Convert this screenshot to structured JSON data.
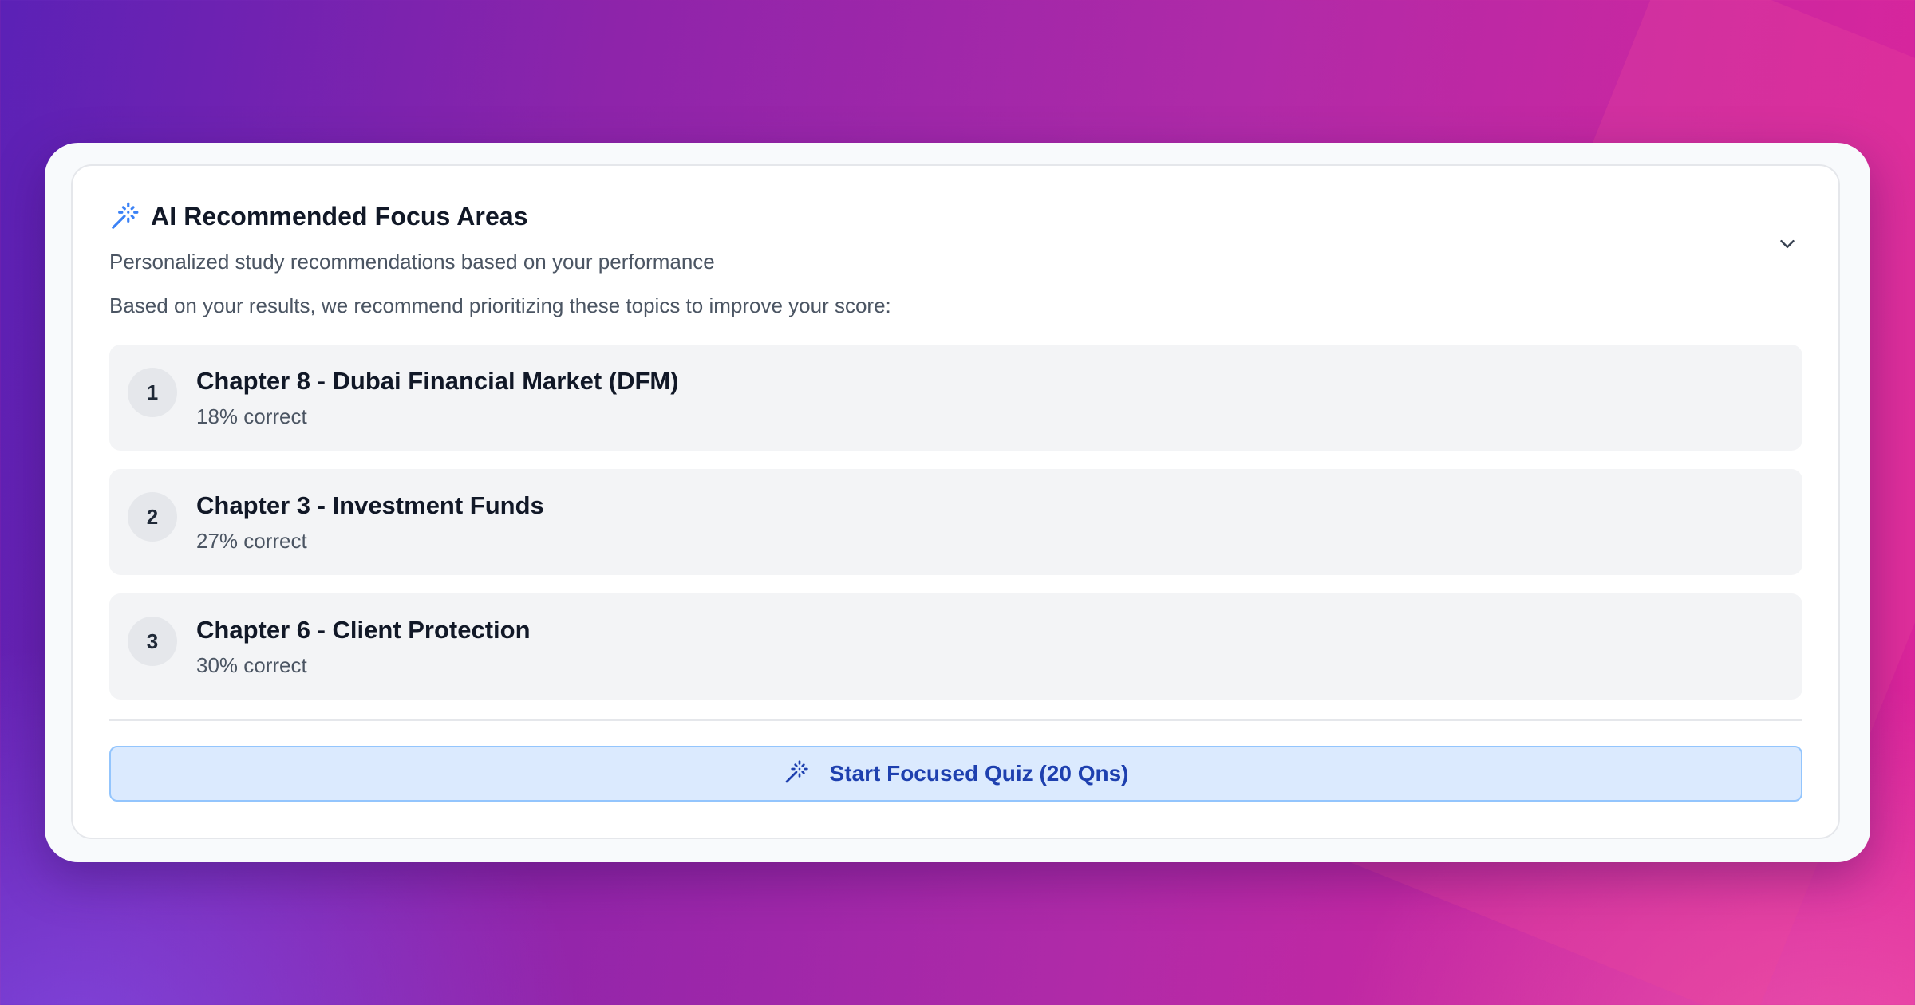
{
  "card": {
    "title": "AI Recommended Focus Areas",
    "subtitle": "Personalized study recommendations based on your performance",
    "intro": "Based on your results, we recommend prioritizing these topics to improve your score:",
    "title_icon": "magic-wand-icon",
    "collapse_icon": "chevron-down-icon"
  },
  "topics": [
    {
      "rank": "1",
      "name": "Chapter 8 - Dubai Financial Market (DFM)",
      "score": "18% correct"
    },
    {
      "rank": "2",
      "name": "Chapter 3 - Investment Funds",
      "score": "27% correct"
    },
    {
      "rank": "3",
      "name": "Chapter 6 - Client Protection",
      "score": "30% correct"
    }
  ],
  "cta": {
    "label": "Start Focused Quiz (20 Qns)",
    "icon": "magic-wand-icon"
  },
  "colors": {
    "accent": "#3b82f6",
    "cta_background": "#dbeafe",
    "cta_border": "#93c5fd",
    "cta_text": "#1e40af",
    "topic_background": "#f3f4f6"
  }
}
